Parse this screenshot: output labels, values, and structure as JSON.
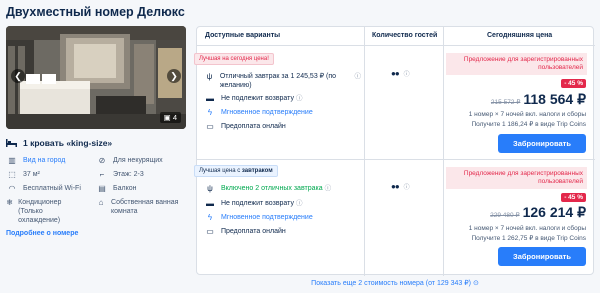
{
  "room": {
    "title": "Двухместный номер Делюкс",
    "photo_count": "4",
    "bed": "1 кровать «king-size»",
    "amenities": [
      {
        "icon": "city-view-icon",
        "label": "Вид на город",
        "link": true
      },
      {
        "icon": "no-smoking-icon",
        "label": "Для некурящих",
        "link": false
      },
      {
        "icon": "area-icon",
        "label": "37 м²",
        "link": false
      },
      {
        "icon": "stairs-icon",
        "label": "Этаж: 2-3",
        "link": false
      },
      {
        "icon": "wifi-icon",
        "label": "Бесплатный Wi-Fi",
        "link": false
      },
      {
        "icon": "balcony-icon",
        "label": "Балкон",
        "link": false
      },
      {
        "icon": "ac-icon",
        "label": "Кондиционер (Только охлаждение)",
        "link": false
      },
      {
        "icon": "bathroom-icon",
        "label": "Собственная ванная комната",
        "link": false
      }
    ],
    "more_link": "Подробнее о номере"
  },
  "table": {
    "headers": {
      "options": "Доступные варианты",
      "guests": "Количество гостей",
      "price": "Сегодняшняя цена"
    },
    "offers": [
      {
        "badge": "Лучшая на сегодня цена!",
        "badge_style": "red",
        "features": [
          {
            "icon": "breakfast-icon",
            "text": "Отличный завтрак за 1 245,53 ₽ (по желанию)",
            "style": "normal",
            "info": true
          },
          {
            "icon": "no-refund-icon",
            "text": "Не подлежит возврату",
            "style": "normal",
            "info": true
          },
          {
            "icon": "lightning-icon",
            "text": "Мгновенное подтверждение",
            "style": "blue",
            "info": false
          },
          {
            "icon": "card-icon",
            "text": "Предоплата онлайн",
            "style": "normal",
            "info": false
          }
        ],
        "guests_icon": "two-guests-icon",
        "promo": "Предложение для зарегистрированных пользователей",
        "discount": "- 45 %",
        "old_price": "215 572 ₽",
        "price": "118 564 ₽",
        "price_note": "1 номер × 7 ночей вкл. налоги и сборы",
        "coins": "Получите 1 186,24 ₽ в виде Trip Coins",
        "book": "Забронировать"
      },
      {
        "badge_prefix": "Лучшая цена с ",
        "badge_bold": "завтраком",
        "badge_style": "blue",
        "features": [
          {
            "icon": "breakfast-icon",
            "text": "Включено 2 отличных завтрака",
            "style": "green",
            "info": true
          },
          {
            "icon": "no-refund-icon",
            "text": "Не подлежит возврату",
            "style": "normal",
            "info": true
          },
          {
            "icon": "lightning-icon",
            "text": "Мгновенное подтверждение",
            "style": "blue",
            "info": false
          },
          {
            "icon": "card-icon",
            "text": "Предоплата онлайн",
            "style": "normal",
            "info": false
          }
        ],
        "guests_icon": "two-guests-icon",
        "promo": "Предложение для зарегистрированных пользователей",
        "discount": "- 45 %",
        "old_price": "229 480 ₽",
        "price": "126 214 ₽",
        "price_note": "1 номер × 7 ночей вкл. налоги и сборы",
        "coins": "Получите 1 262,75 ₽ в виде Trip Coins",
        "book": "Забронировать"
      }
    ]
  },
  "footer": {
    "show_more": "Показать еще 2 стоимость номера (от 129 343 ₽)"
  },
  "colors": {
    "accent": "#287dfa",
    "discount": "#e3284b",
    "green": "#00a84f",
    "text": "#0f294d"
  }
}
